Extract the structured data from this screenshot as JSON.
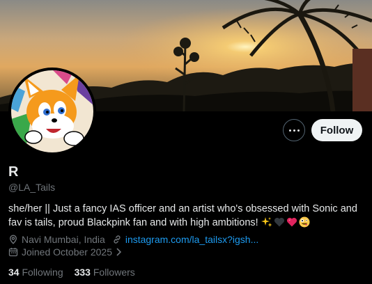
{
  "profile": {
    "name": "R",
    "handle": "@LA_Tails",
    "bio_text": "she/her || Just a fancy IAS officer and an artist who's obsessed with Sonic and fav is tails, proud Blackpink fan and with high ambitions!",
    "bio_emojis": [
      "sparkles-emoji",
      "black-heart-emoji",
      "heart-emoji",
      "zany-face-emoji"
    ],
    "location": "Navi Mumbai, India",
    "website": "instagram.com/la_tailsx?igsh...",
    "joined": "Joined October 2025",
    "following_count": "34",
    "following_label": "Following",
    "followers_count": "333",
    "followers_label": "Followers"
  },
  "actions": {
    "follow_label": "Follow",
    "more_icon": "more-horizontal-icon"
  },
  "colors": {
    "background": "#000000",
    "primary_text": "#e7e9ea",
    "secondary_text": "#71767b",
    "link": "#1d9bf0",
    "follow_button_bg": "#eff3f4"
  }
}
